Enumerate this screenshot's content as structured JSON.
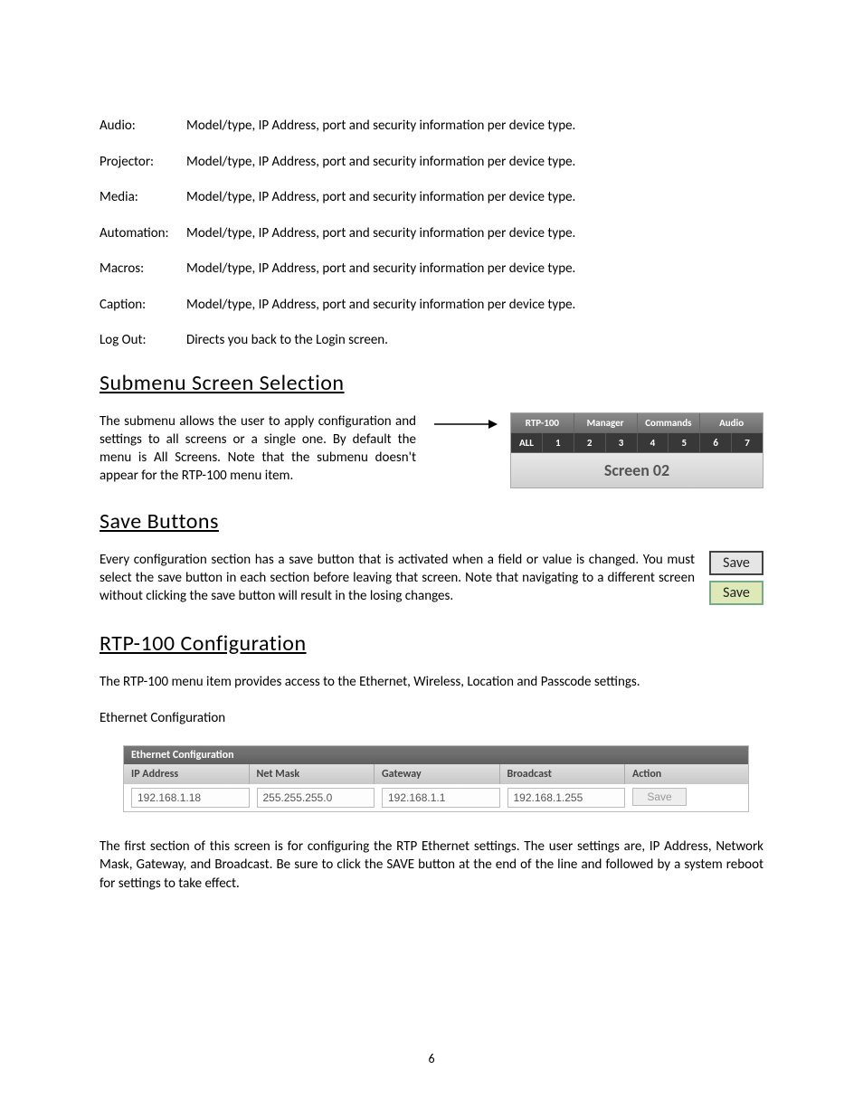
{
  "definitions": [
    {
      "term": "Audio:",
      "desc": "Model/type, IP Address, port and security information per device type."
    },
    {
      "term": "Projector:",
      "desc": "Model/type, IP Address, port and security information per device type."
    },
    {
      "term": "Media:",
      "desc": "Model/type, IP Address, port and security information per device type."
    },
    {
      "term": "Automation:",
      "desc": "Model/type, IP Address, port and security information per device type."
    },
    {
      "term": "Macros:",
      "desc": "Model/type, IP Address, port and security information per device type."
    },
    {
      "term": "Caption:",
      "desc": "Model/type, IP Address, port and security information per device type."
    },
    {
      "term": "Log Out:",
      "desc": "Directs you back to the Login screen."
    }
  ],
  "headings": {
    "submenu": "Submenu Screen Selection",
    "save": "Save Buttons",
    "rtp": "RTP-100 Configuration"
  },
  "submenu": {
    "text": "The submenu allows the user to apply configuration and settings to all screens or a single one.  By default the menu is All Screens.   Note that the submenu doesn't appear for the RTP-100 menu item.",
    "topTabs": [
      "RTP-100",
      "Manager",
      "Commands",
      "Audio"
    ],
    "subTabs": [
      "ALL",
      "1",
      "2",
      "3",
      "4",
      "5",
      "6",
      "7"
    ],
    "title": "Screen 02"
  },
  "save": {
    "text": "Every configuration section has a save button that is activated when a field or value is changed.  You must select the save button in each section before leaving that screen.  Note that navigating to a different screen without clicking the save button will result in the losing changes.",
    "btn1": "Save",
    "btn2": "Save"
  },
  "rtp": {
    "text": "The RTP-100 menu item provides access to the Ethernet, Wireless, Location and Passcode settings.",
    "ethLabel": "Ethernet Configuration",
    "panelTitle": "Ethernet Configuration",
    "cols": {
      "ip": "IP Address",
      "mask": "Net Mask",
      "gw": "Gateway",
      "bc": "Broadcast",
      "action": "Action"
    },
    "values": {
      "ip": "192.168.1.18",
      "mask": "255.255.255.0",
      "gw": "192.168.1.1",
      "bc": "192.168.1.255",
      "save": "Save"
    },
    "after": "The first section of this screen is for configuring the RTP Ethernet settings. The user settings are, IP Address, Network Mask, Gateway, and Broadcast.  Be sure to click the SAVE button at the end of the line and followed by a system reboot for settings to take effect."
  },
  "pageNumber": "6"
}
